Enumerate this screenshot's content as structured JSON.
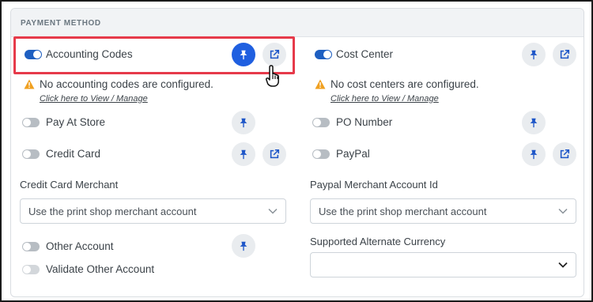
{
  "section": {
    "title": "PAYMENT METHOD"
  },
  "left": {
    "accounting_codes": {
      "label": "Accounting Codes",
      "warning": "No accounting codes are configured.",
      "link": "Click here to View / Manage"
    },
    "pay_at_store": {
      "label": "Pay At Store"
    },
    "credit_card": {
      "label": "Credit Card"
    },
    "credit_card_merchant": {
      "label": "Credit Card Merchant",
      "value": "Use the print shop merchant account"
    },
    "other_account": {
      "label": "Other Account"
    },
    "validate_other_account": {
      "label": "Validate Other Account"
    }
  },
  "right": {
    "cost_center": {
      "label": "Cost Center",
      "warning": "No cost centers are configured.",
      "link": "Click here to View / Manage"
    },
    "po_number": {
      "label": "PO Number"
    },
    "paypal": {
      "label": "PayPal"
    },
    "paypal_merchant": {
      "label": "Paypal Merchant Account Id",
      "value": "Use the print shop merchant account"
    },
    "alternate_currency": {
      "label": "Supported Alternate Currency",
      "value": ""
    }
  },
  "icons": {
    "pin": "pin-icon",
    "external": "external-link-icon",
    "warning": "warning-icon",
    "chevron": "chevron-down-icon",
    "cursor": "hand-cursor-icon"
  },
  "colors": {
    "accent": "#1e5fc1",
    "primary_button": "#1f5fe0",
    "highlight": "#e63a4a",
    "warning": "#f0a020"
  }
}
